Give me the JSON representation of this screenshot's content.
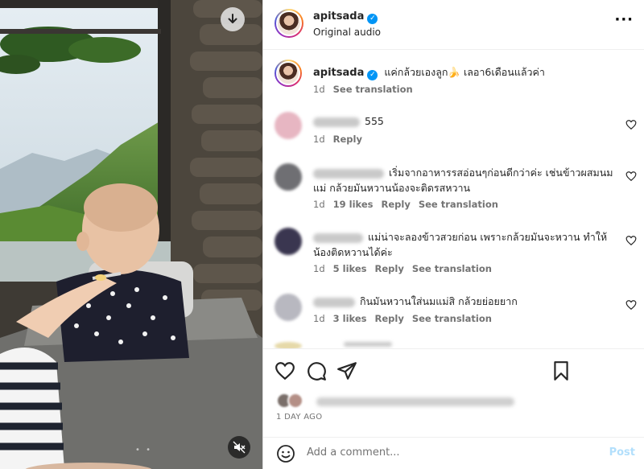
{
  "post": {
    "username": "apitsada",
    "audio": "Original audio",
    "caption": "แค่กล้วยเองลูก🍌 เลอา6เดือนแล้วค่า",
    "caption_age": "1d",
    "see_translation": "See translation"
  },
  "comments": [
    {
      "age": "1d",
      "text": "555",
      "likes": "",
      "reply": "Reply",
      "translation": ""
    },
    {
      "age": "1d",
      "text": "เริ่มจากอาหารรสอ่อนๆก่อนดีกว่าค่ะ เช่นข้าวผสมนมแม่ กล้วยมันหวานน้องจะติดรสหวาน",
      "likes": "19 likes",
      "reply": "Reply",
      "translation": "See translation"
    },
    {
      "age": "1d",
      "text": "แม่น่าจะลองข้าวสวยก่อน เพราะกล้วยมันจะหวาน ทำให้น้องติดหวานได้ค่ะ",
      "likes": "5 likes",
      "reply": "Reply",
      "translation": "See translation"
    },
    {
      "age": "1d",
      "text": "กินมันหวานใส่นมแม่สิ กล้วยย่อยยาก",
      "likes": "3 likes",
      "reply": "Reply",
      "translation": "See translation"
    }
  ],
  "footer": {
    "date": "1 DAY AGO",
    "add_comment_placeholder": "Add a comment...",
    "post_label": "Post"
  },
  "icons": {
    "download": "download-icon",
    "mute": "muted-speaker-icon",
    "more": "more-options-icon",
    "heart": "heart-icon",
    "comment": "comment-icon",
    "share": "share-icon",
    "save": "bookmark-icon",
    "emoji": "emoji-icon"
  },
  "colors": {
    "verified": "#0095f6",
    "post_disabled": "#b2dffc",
    "muted_text": "#737373"
  }
}
